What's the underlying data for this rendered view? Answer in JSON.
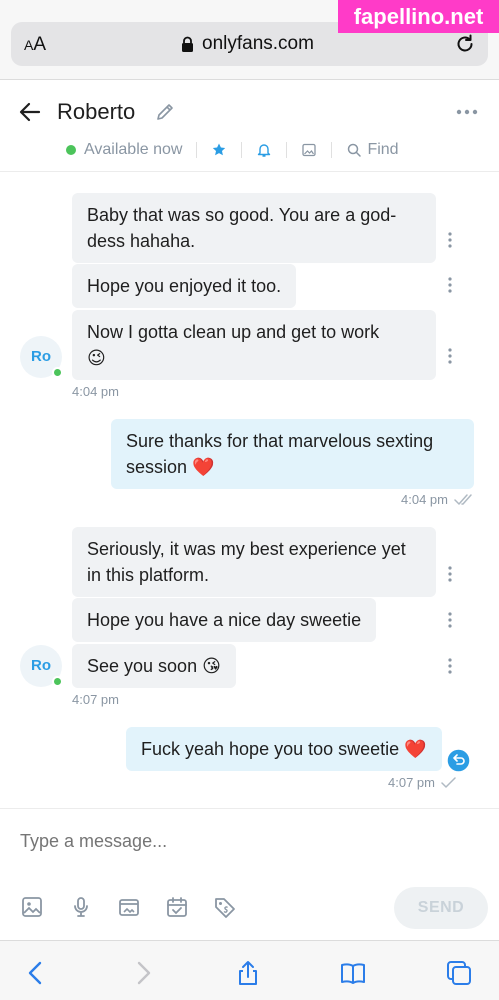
{
  "browser": {
    "text_size_label": "AA",
    "url": "onlyfans.com"
  },
  "watermark": "fapellino.net",
  "header": {
    "name": "Roberto",
    "status": "Available now",
    "find_label": "Find"
  },
  "avatar_initials": "Ro",
  "messages": [
    {
      "dir": "in",
      "text": "Baby that was so good. You are a god-dess hahaha."
    },
    {
      "dir": "in",
      "text": "Hope you enjoyed it too."
    },
    {
      "dir": "in",
      "text": "Now I gotta clean up and get to work",
      "emoji": "😉"
    },
    {
      "dir": "time-in",
      "text": "4:04 pm"
    },
    {
      "dir": "out",
      "text": "Sure thanks for that marvelous sexting session",
      "emoji": "❤️"
    },
    {
      "dir": "time-out",
      "text": "4:04 pm"
    },
    {
      "dir": "in",
      "text": "Seriously, it was my best experience yet in this platform."
    },
    {
      "dir": "in",
      "text": "Hope you have a nice day sweetie"
    },
    {
      "dir": "in",
      "text": "See you soon",
      "emoji": "😘"
    },
    {
      "dir": "time-in",
      "text": "4:07 pm"
    },
    {
      "dir": "out",
      "text": "Fuck yeah hope you too sweetie",
      "emoji": "❤️"
    },
    {
      "dir": "time-out",
      "text": "4:07 pm"
    }
  ],
  "composer": {
    "placeholder": "Type a message...",
    "send_label": "SEND"
  },
  "colors": {
    "accent": "#00aff0",
    "online": "#4cc45b",
    "incoming_bubble": "#f0f2f4",
    "outgoing_bubble": "#e2f3fb"
  }
}
